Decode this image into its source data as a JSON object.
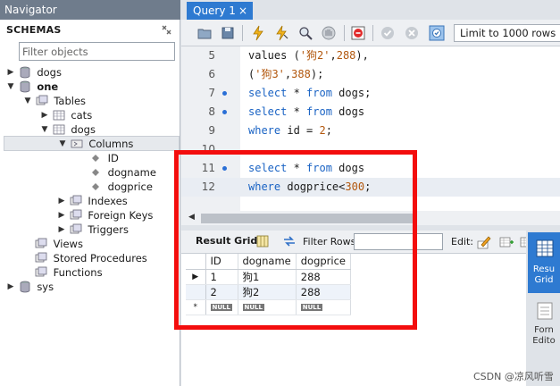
{
  "navigator": {
    "title": "Navigator",
    "schemas_label": "SCHEMAS",
    "filter_placeholder": "Filter objects",
    "tree": {
      "dogs_db": "dogs",
      "one_db": "one",
      "tables": "Tables",
      "cats": "cats",
      "dogs_table": "dogs",
      "columns": "Columns",
      "col_id": "ID",
      "col_dogname": "dogname",
      "col_dogprice": "dogprice",
      "indexes": "Indexes",
      "foreign_keys": "Foreign Keys",
      "triggers": "Triggers",
      "views": "Views",
      "stored_procedures": "Stored Procedures",
      "functions": "Functions",
      "sys_db": "sys"
    }
  },
  "tab": {
    "label": "Query 1",
    "close": "×"
  },
  "toolbar": {
    "limit_label": "Limit to 1000 rows"
  },
  "editor": {
    "lines": [
      {
        "num": "5",
        "t1": "values (",
        "s1": "'狗2'",
        "t2": ",",
        "n1": "288",
        "t3": "),"
      },
      {
        "num": "6",
        "t1": "(",
        "s1": "'狗3'",
        "t2": ",",
        "n1": "388",
        "t3": ");"
      },
      {
        "num": "7",
        "k1": "select",
        "t1": " * ",
        "k2": "from",
        "t2": " dogs;"
      },
      {
        "num": "8",
        "k1": "select",
        "t1": " * ",
        "k2": "from",
        "t2": " dogs"
      },
      {
        "num": "9",
        "k1": "where",
        "t1": " id = ",
        "n1": "2",
        "t2": ";"
      },
      {
        "num": "10"
      },
      {
        "num": "11",
        "k1": "select",
        "t1": " * ",
        "k2": "from",
        "t2": " dogs"
      },
      {
        "num": "12",
        "k1": "where",
        "t1": " dogprice<",
        "n1": "300",
        "t2": ";"
      }
    ]
  },
  "results": {
    "result_grid_label": "Result Grid",
    "filter_rows_label": "Filter Rows:",
    "edit_label": "Edit:",
    "columns": [
      "ID",
      "dogname",
      "dogprice"
    ],
    "rows": [
      [
        "1",
        "狗1",
        "288"
      ],
      [
        "2",
        "狗2",
        "288"
      ]
    ],
    "null_label": "NULL",
    "new_row_marker": "*"
  },
  "side_panel": {
    "result_grid_l1": "Resu",
    "result_grid_l2": "Grid",
    "form_editor_l1": "Forn",
    "form_editor_l2": "Edito"
  },
  "watermark": "CSDN @凉风听雪"
}
